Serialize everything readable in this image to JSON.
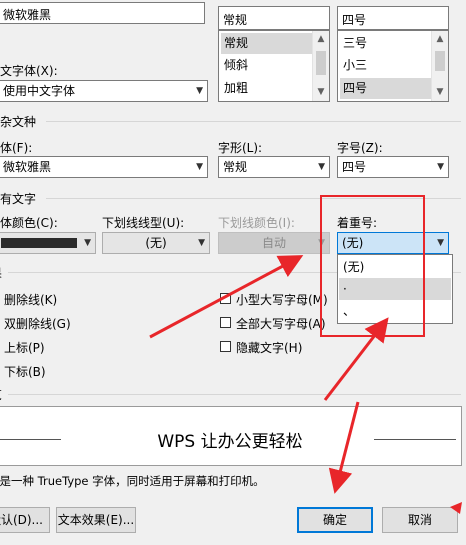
{
  "font_row": {
    "chinese_font_value": "微软雅黑",
    "style_list": [
      "常规",
      "倾斜",
      "加粗"
    ],
    "style_selected": "常规",
    "size_list": [
      "三号",
      "小三",
      "四号"
    ],
    "size_selected": "四号",
    "style_input": "常规",
    "size_input": "四号"
  },
  "western": {
    "label": "西文字体(X):",
    "value": "使用中文字体"
  },
  "complex": {
    "section": "复杂文种",
    "font_label": "字体(F):",
    "font_value": "微软雅黑",
    "style_label": "字形(L):",
    "style_value": "常规",
    "size_label": "字号(Z):",
    "size_value": "四号"
  },
  "all_text": {
    "section": "所有文字",
    "color_label": "字体颜色(C):",
    "underline_label": "下划线线型(U):",
    "underline_value": "(无)",
    "underline_color_label": "下划线颜色(I):",
    "underline_color_value": "自动",
    "emphasis_label": "着重号:",
    "emphasis_value": "(无)",
    "emphasis_options": [
      "(无)",
      "·",
      "、"
    ]
  },
  "effects": {
    "section": "效果",
    "items_left": [
      "删除线(K)",
      "双删除线(G)",
      "上标(P)",
      "下标(B)"
    ],
    "items_right": [
      "小型大写字母(M)",
      "全部大写字母(A)",
      "隐藏文字(H)"
    ]
  },
  "preview": {
    "section": "预览",
    "text": "WPS 让办公更轻松",
    "note": "这是一种 TrueType 字体，同时适用于屏幕和打印机。"
  },
  "buttons": {
    "default": "默认(D)...",
    "text_effects": "文本效果(E)...",
    "ok": "确定",
    "cancel": "取消"
  },
  "colors": {
    "annotation_red": "#e8262a",
    "focus_blue": "#cce4f7"
  }
}
